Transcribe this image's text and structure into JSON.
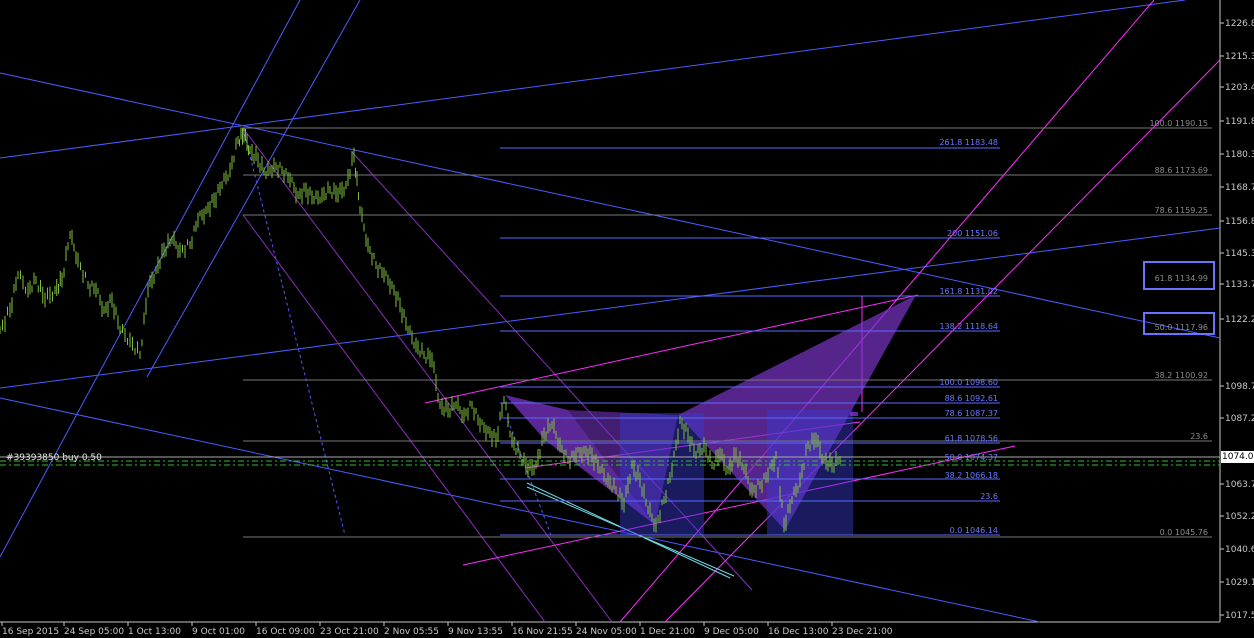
{
  "colors": {
    "background": "#000000",
    "axis_text": "#c8c8c8",
    "candles": "#7fbf3f",
    "trendline_blue": "#4a5cff",
    "trendline_magenta": "#ff2dff",
    "fib_gray": "#777777",
    "fib_blue": "#5a6aff",
    "pattern_fill": "#7a34c8",
    "pattern_fill_blue": "#3a3ad0",
    "order_line": "#2fbf2f",
    "highlight_box": "#6b72ff"
  },
  "price_axis": {
    "labels": [
      "1226.85",
      "1215.30",
      "1203.40",
      "1191.85",
      "1180.30",
      "1168.75",
      "1156.85",
      "1145.30",
      "1133.75",
      "1122.20",
      "1098.75",
      "1087.20",
      "1063.75",
      "1052.20",
      "1040.65",
      "1029.10",
      "1017.55"
    ],
    "current_price": "1074.00"
  },
  "time_axis": {
    "labels": [
      "16 Sep 2015",
      "24 Sep 05:00",
      "1 Oct 13:00",
      "9 Oct 01:00",
      "16 Oct 09:00",
      "23 Oct 21:00",
      "2 Nov 05:55",
      "9 Nov 13:55",
      "16 Nov 21:55",
      "24 Nov 05:00",
      "1 Dec 21:00",
      "9 Dec 05:00",
      "16 Dec 13:00",
      "23 Dec 21:00"
    ]
  },
  "fib_labels": {
    "gray": [
      "100.0 1190.15",
      "88.6 1173.69",
      "78.6 1159.25",
      "38.2 1100.92",
      "23.6",
      "0.0 1045.76"
    ],
    "blue": [
      "261.8 1183.48",
      "200 1151.06",
      "161.8 1131.02",
      "138.2 1118.64",
      "100.0 1098.60",
      "88.6 1092.61",
      "78.6 1087.37",
      "61.8 1078.56",
      "50.0 1074.37",
      "38.2 1066.18",
      "23.6",
      "0.0 1046.14"
    ],
    "boxed": [
      "61.8 1134.99",
      "50.0 1117.96"
    ]
  },
  "order": {
    "label": "#39393850 buy 0.50"
  }
}
